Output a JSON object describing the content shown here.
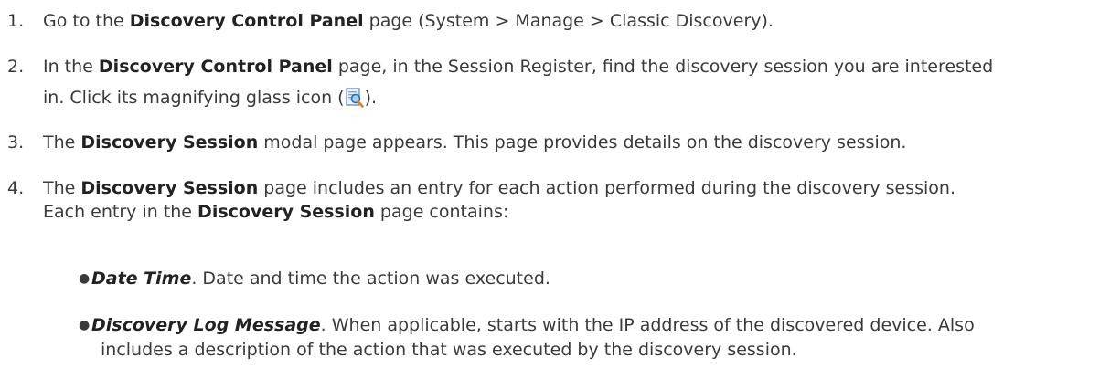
{
  "steps": [
    {
      "num": "1.",
      "pre": "Go to the ",
      "bold": "Discovery Control Panel",
      "post": " page (System > Manage > Classic Discovery)."
    },
    {
      "num": "2.",
      "pre": "In the ",
      "bold": "Discovery Control Panel",
      "post": " page, in the Session Register, find the discovery session you are interested",
      "line2_pre": "in. Click its magnifying glass icon (",
      "icon": "magnifying-glass-document-icon",
      "line2_post": ")."
    },
    {
      "num": "3.",
      "pre": "The ",
      "bold": "Discovery Session",
      "post": " modal page appears. This page provides details on the discovery session."
    },
    {
      "num": "4.",
      "pre": "The ",
      "bold": "Discovery Session",
      "post": " page includes an entry for each action performed during the discovery session.",
      "line2_pre": "Each entry in the ",
      "line2_bold": "Discovery Session",
      "line2_post": " page contains:"
    }
  ],
  "bullets": [
    {
      "term": "Date Time",
      "text": ". Date and time the action was executed."
    },
    {
      "term": "Discovery Log Message",
      "text": ". When applicable, starts with the IP address of the discovered device. Also",
      "cont": "includes a description of the action that was executed by the discovery session."
    }
  ]
}
